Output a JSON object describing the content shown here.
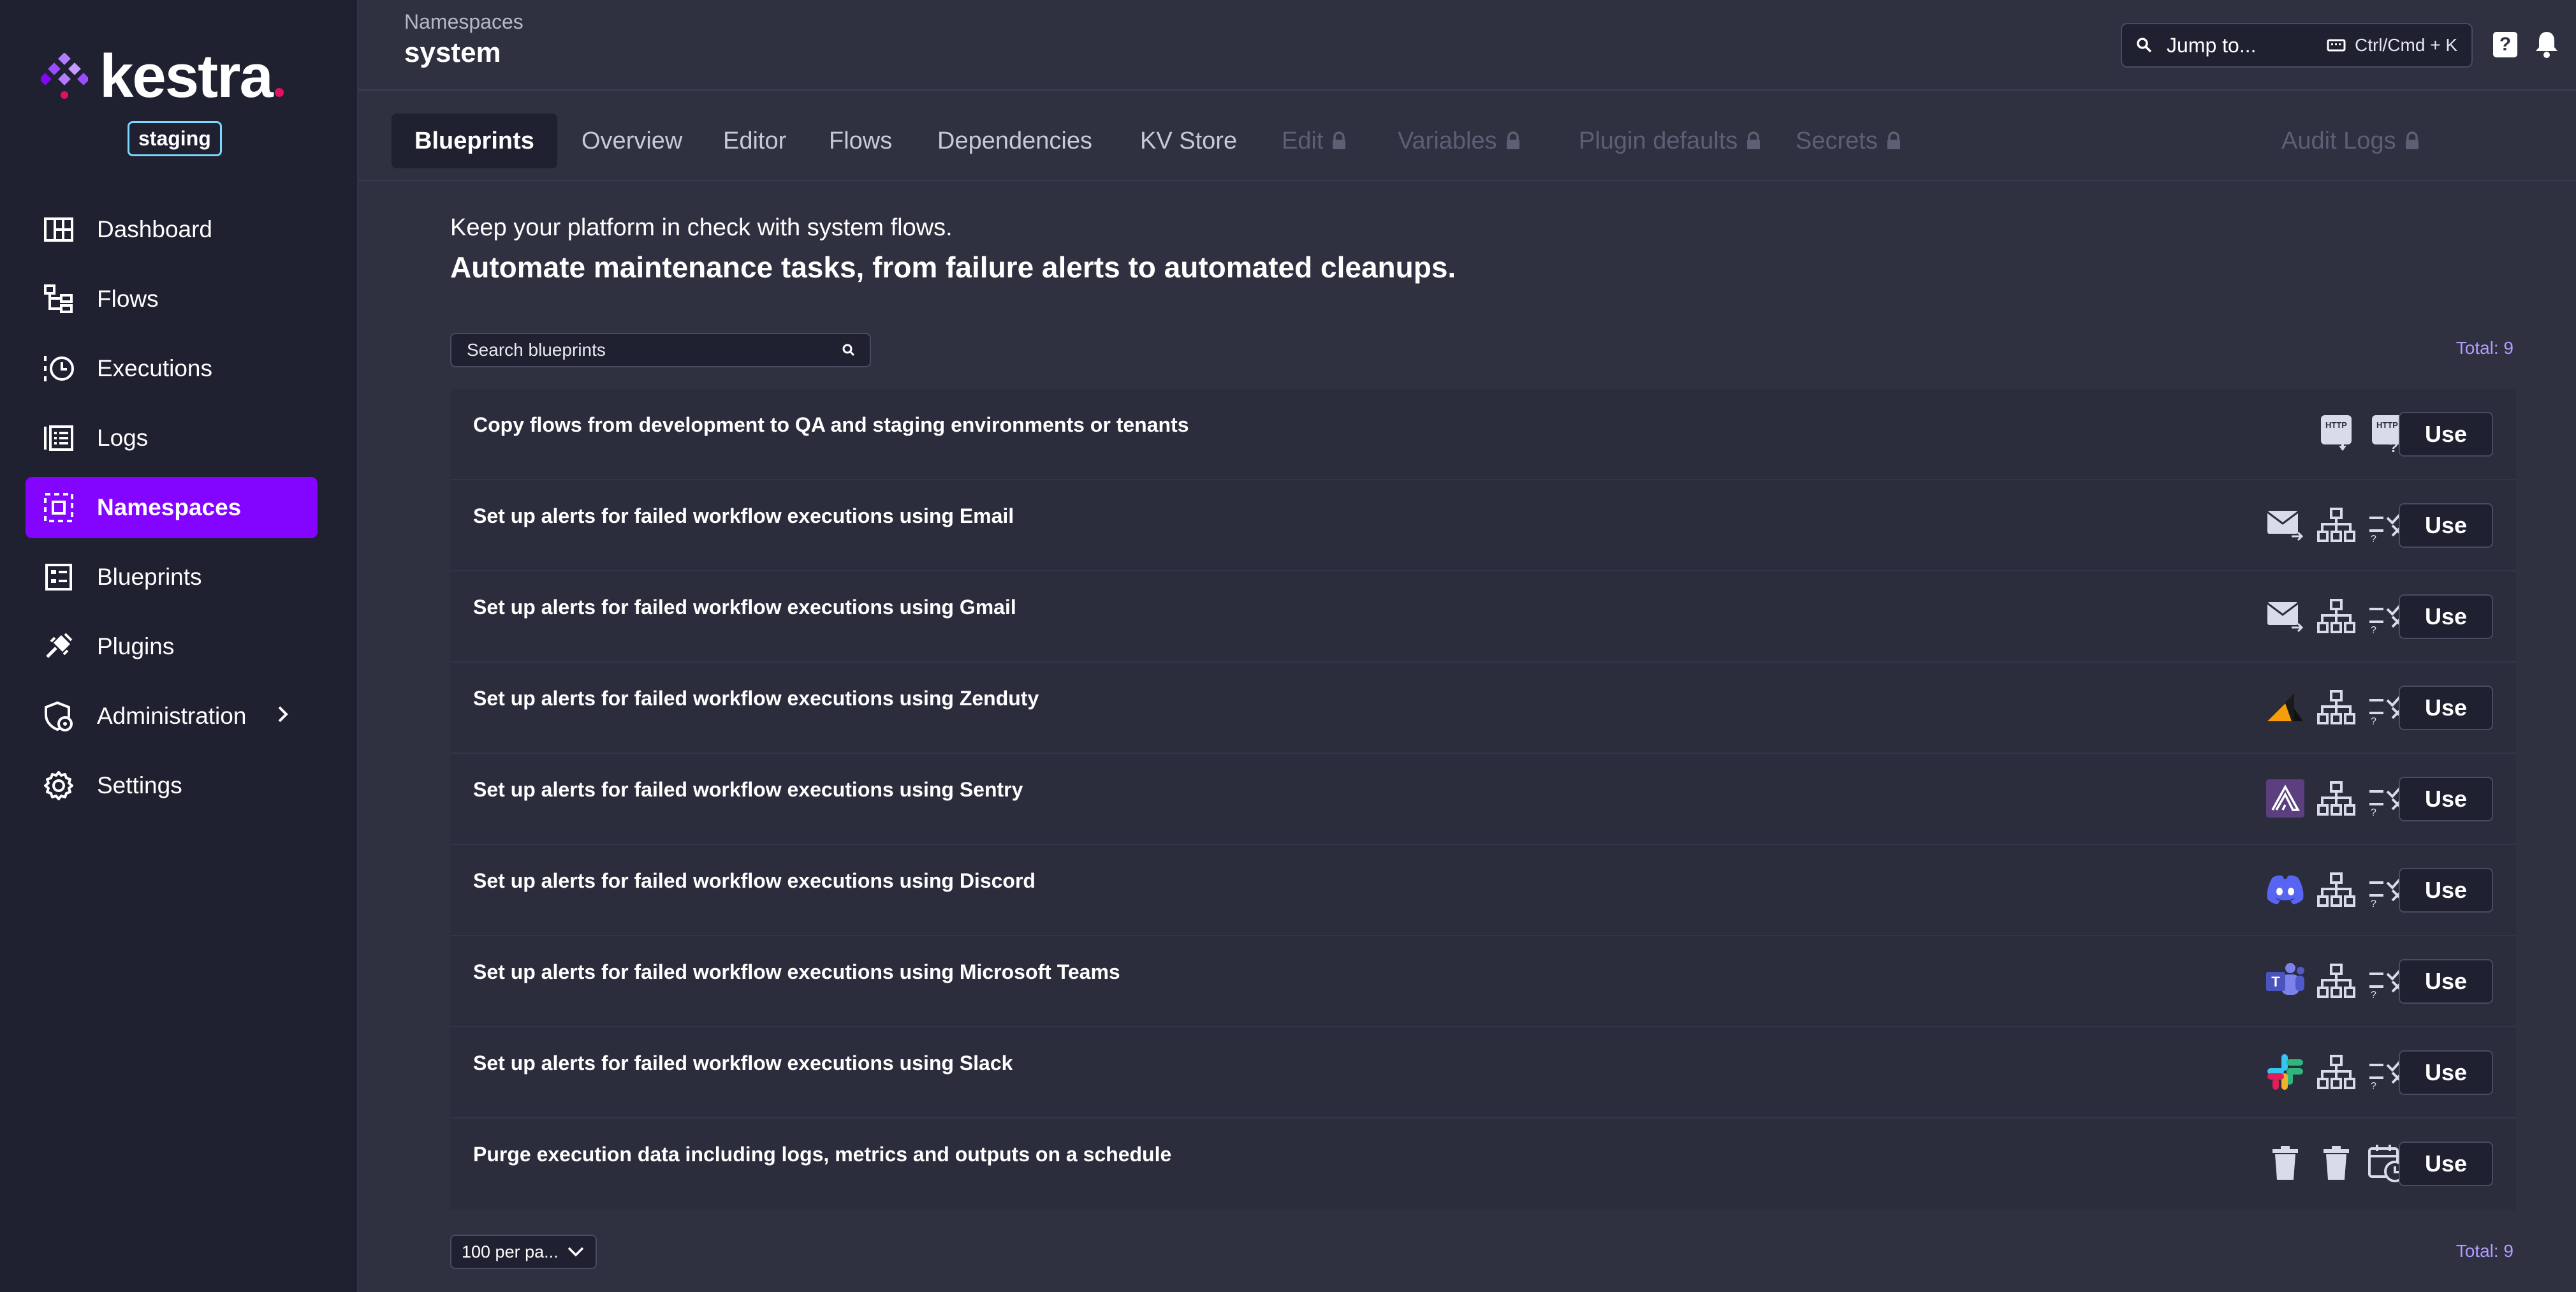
{
  "app": {
    "name": "kestra",
    "environment": "staging"
  },
  "sidebar": {
    "items": [
      {
        "label": "Dashboard",
        "icon": "dashboard-icon"
      },
      {
        "label": "Flows",
        "icon": "flows-icon"
      },
      {
        "label": "Executions",
        "icon": "executions-icon"
      },
      {
        "label": "Logs",
        "icon": "logs-icon"
      },
      {
        "label": "Namespaces",
        "icon": "namespaces-icon",
        "active": true
      },
      {
        "label": "Blueprints",
        "icon": "blueprints-icon"
      },
      {
        "label": "Plugins",
        "icon": "plugins-icon"
      },
      {
        "label": "Administration",
        "icon": "administration-icon"
      },
      {
        "label": "Settings",
        "icon": "gear-icon"
      }
    ]
  },
  "header": {
    "breadcrumb": "Namespaces",
    "title": "system",
    "jump_label": "Jump to...",
    "shortcut": "Ctrl/Cmd + K",
    "help_label": "?"
  },
  "tabs": [
    {
      "label": "Blueprints",
      "active": true
    },
    {
      "label": "Overview"
    },
    {
      "label": "Editor"
    },
    {
      "label": "Flows"
    },
    {
      "label": "Dependencies"
    },
    {
      "label": "KV Store"
    },
    {
      "label": "Edit",
      "locked": true
    },
    {
      "label": "Variables",
      "locked": true
    },
    {
      "label": "Plugin defaults",
      "locked": true
    },
    {
      "label": "Secrets",
      "locked": true
    },
    {
      "label": "Audit Logs",
      "locked": true
    }
  ],
  "intro": {
    "line1": "Keep your platform in check with system flows.",
    "line2": "Automate maintenance tasks, from failure alerts to automated cleanups."
  },
  "search": {
    "placeholder": "Search blueprints"
  },
  "total_label": "Total: 9",
  "use_label": "Use",
  "blueprints": [
    {
      "title": "Copy flows from development to QA and staging environments or tenants",
      "icons": [
        "http-download-icon",
        "http-request-icon"
      ]
    },
    {
      "title": "Set up alerts for failed workflow executions using Email",
      "icons": [
        "email-icon",
        "hierarchy-icon",
        "switch-icon"
      ]
    },
    {
      "title": "Set up alerts for failed workflow executions using Gmail",
      "icons": [
        "email-icon",
        "hierarchy-icon",
        "switch-icon"
      ]
    },
    {
      "title": "Set up alerts for failed workflow executions using Zenduty",
      "icons": [
        "zenduty-icon",
        "hierarchy-icon",
        "switch-icon"
      ]
    },
    {
      "title": "Set up alerts for failed workflow executions using Sentry",
      "icons": [
        "sentry-icon",
        "hierarchy-icon",
        "switch-icon"
      ]
    },
    {
      "title": "Set up alerts for failed workflow executions using Discord",
      "icons": [
        "discord-icon",
        "hierarchy-icon",
        "switch-icon"
      ]
    },
    {
      "title": "Set up alerts for failed workflow executions using Microsoft Teams",
      "icons": [
        "teams-icon",
        "hierarchy-icon",
        "switch-icon"
      ]
    },
    {
      "title": "Set up alerts for failed workflow executions using Slack",
      "icons": [
        "slack-icon",
        "hierarchy-icon",
        "switch-icon"
      ]
    },
    {
      "title": "Purge execution data including logs, metrics and outputs on a schedule",
      "icons": [
        "trash-icon",
        "trash-icon",
        "calendar-clock-icon"
      ]
    }
  ],
  "pagination": {
    "per_page_label": "100 per pa..."
  },
  "colors": {
    "accent": "#8405ff",
    "sidebar_bg": "#1f2030",
    "main_bg": "#2f3040",
    "total_text": "#b39cff"
  }
}
